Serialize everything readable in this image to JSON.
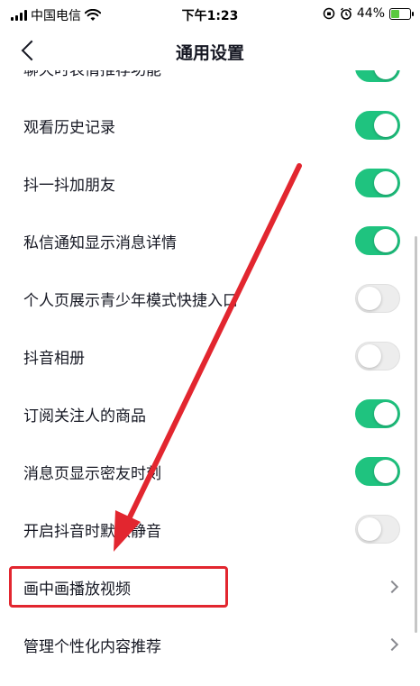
{
  "status_bar": {
    "carrier": "中国电信",
    "time": "下午1:23",
    "battery": "44%",
    "battery_level": 0.44
  },
  "nav": {
    "title": "通用设置",
    "back_icon": "chevron-left-icon"
  },
  "settings": [
    {
      "label": "聊天时表情推荐功能",
      "control": "toggle",
      "on": true
    },
    {
      "label": "观看历史记录",
      "control": "toggle",
      "on": true
    },
    {
      "label": "抖一抖加朋友",
      "control": "toggle",
      "on": true
    },
    {
      "label": "私信通知显示消息详情",
      "control": "toggle",
      "on": true
    },
    {
      "label": "个人页展示青少年模式快捷入口",
      "control": "toggle",
      "on": false
    },
    {
      "label": "抖音相册",
      "control": "toggle",
      "on": false
    },
    {
      "label": "订阅关注人的商品",
      "control": "toggle",
      "on": true
    },
    {
      "label": "消息页显示密友时刻",
      "control": "toggle",
      "on": true
    },
    {
      "label": "开启抖音时默认静音",
      "control": "toggle",
      "on": false
    },
    {
      "label": "画中画播放视频",
      "control": "chevron",
      "highlighted": true
    },
    {
      "label": "管理个性化内容推荐",
      "control": "chevron"
    }
  ],
  "colors": {
    "toggle_on": "#1fc37f",
    "toggle_off": "#ededed",
    "annotation": "#e2262f"
  }
}
